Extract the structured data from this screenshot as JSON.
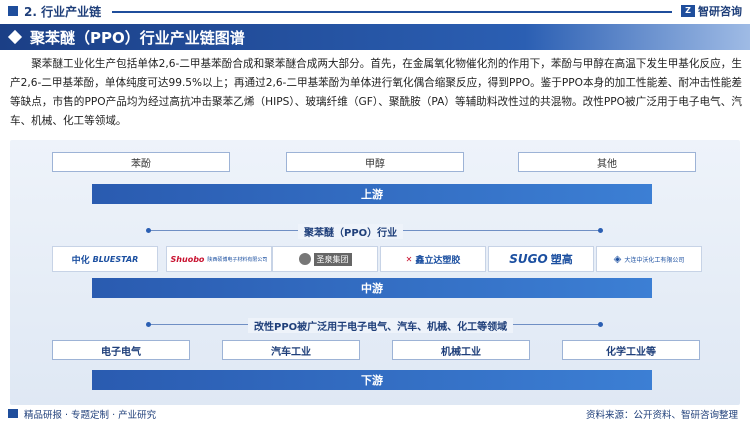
{
  "header": {
    "section": "2. 行业产业链",
    "logo_name": "智研咨询",
    "title": "聚苯醚（PPO）行业产业链图谱"
  },
  "intro": "聚苯醚工业化生产包括单体2,6-二甲基苯酚合成和聚苯醚合成两大部分。首先，在金属氧化物催化剂的作用下，苯酚与甲醇在高温下发生甲基化反应，生产2,6-二甲基苯酚，单体纯度可达99.5%以上；再通过2,6-二甲基苯酚为单体进行氧化偶合缩聚反应，得到PPO。鉴于PPO本身的加工性能差、耐冲击性能差等缺点，市售的PPO产品均为经过高抗冲击聚苯乙烯（HIPS）、玻璃纤维（GF）、聚酰胺（PA）等辅助料改性过的共混物。改性PPO被广泛用于电子电气、汽车、机械、化工等领域。",
  "upstream": {
    "items": [
      "苯酚",
      "甲醇",
      "其他"
    ],
    "label": "上游"
  },
  "midstream": {
    "heading": "聚苯醚（PPO）行业",
    "label": "中游",
    "logos": [
      {
        "text1": "中化",
        "text2": "BLUESTAR",
        "color": "#1b4fa0"
      },
      {
        "text1": "Shuobo",
        "text2": "陕西硕博电子材料有限公司",
        "color": "#c8102e"
      },
      {
        "text1": "圣泉集团",
        "text2": "",
        "color": "#555555"
      },
      {
        "text1": "鑫立达塑胶",
        "text2": "",
        "color": "#1b4fa0"
      },
      {
        "text1": "SUGO",
        "text2": "塑高",
        "color": "#1b4fa0"
      },
      {
        "text1": "大连中沃化工有限公司",
        "text2": "",
        "color": "#1b4fa0"
      }
    ]
  },
  "downstream": {
    "heading": "改性PPO被广泛用于电子电气、汽车、机械、化工等领域",
    "items": [
      "电子电气",
      "汽车工业",
      "机械工业",
      "化学工业等"
    ],
    "label": "下游"
  },
  "footer": {
    "left": "精品研报 · 专题定制 · 产业研究",
    "right": "资料来源：公开资料、智研咨询整理"
  },
  "colors": {
    "primary": "#1f4e9c",
    "band": "#2a5bb0",
    "panel": "#e6eef8"
  }
}
